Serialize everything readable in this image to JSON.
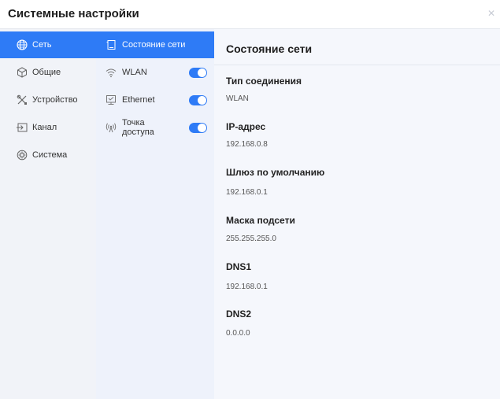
{
  "window": {
    "title": "Системные настройки"
  },
  "colors": {
    "accent": "#2e7bf6"
  },
  "nav": [
    {
      "label": "Сеть",
      "icon": "globe-icon",
      "active": true
    },
    {
      "label": "Общие",
      "icon": "cube-icon",
      "active": false
    },
    {
      "label": "Устройство",
      "icon": "tools-icon",
      "active": false
    },
    {
      "label": "Канал",
      "icon": "input-icon",
      "active": false
    },
    {
      "label": "Система",
      "icon": "gear-icon",
      "active": false
    }
  ],
  "subnav": [
    {
      "label": "Состояние сети",
      "icon": "network-status-icon",
      "active": true
    },
    {
      "label": "WLAN",
      "icon": "wifi-icon",
      "toggle": "on"
    },
    {
      "label": "Ethernet",
      "icon": "ethernet-icon",
      "toggle": "on"
    },
    {
      "label_line1": "Точка",
      "label_line2": "доступа",
      "icon": "hotspot-icon",
      "toggle": "on"
    }
  ],
  "detail": {
    "title": "Состояние сети",
    "fields": [
      {
        "label": "Тип соединения",
        "value": "WLAN"
      },
      {
        "label": "IP-адрес",
        "value": "192.168.0.8"
      },
      {
        "label": "Шлюз по умолчанию",
        "value": "192.168.0.1"
      },
      {
        "label": "Маска подсети",
        "value": "255.255.255.0"
      },
      {
        "label": "DNS1",
        "value": "192.168.0.1"
      },
      {
        "label": "DNS2",
        "value": "0.0.0.0"
      }
    ]
  }
}
